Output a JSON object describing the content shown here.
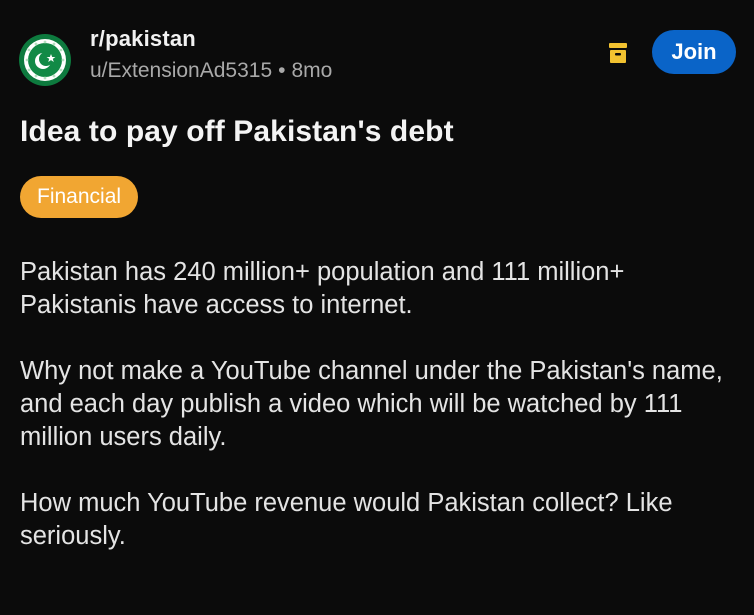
{
  "post": {
    "subreddit": "r/pakistan",
    "author": "u/ExtensionAd5315",
    "separator": "•",
    "age": "8mo",
    "join_label": "Join",
    "title": "Idea to pay off Pakistan's debt",
    "flair": "Financial",
    "paragraphs": [
      "Pakistan has 240 million+ population and 111 million+ Pakistanis have access to internet.",
      "Why not make a YouTube channel under the Pakistan's name, and each day publish a video which will be watched by 111 million users daily.",
      "How much YouTube revenue would Pakistan collect? Like seriously."
    ]
  },
  "icons": {
    "avatar": "subreddit-avatar-icon",
    "mod": "mod-tools-icon"
  },
  "colors": {
    "background": "#0b0b0b",
    "join_button": "#0a64c8",
    "flair": "#f1a632",
    "mod_icon": "#f2c230",
    "avatar_green": "#0d7a3e"
  }
}
